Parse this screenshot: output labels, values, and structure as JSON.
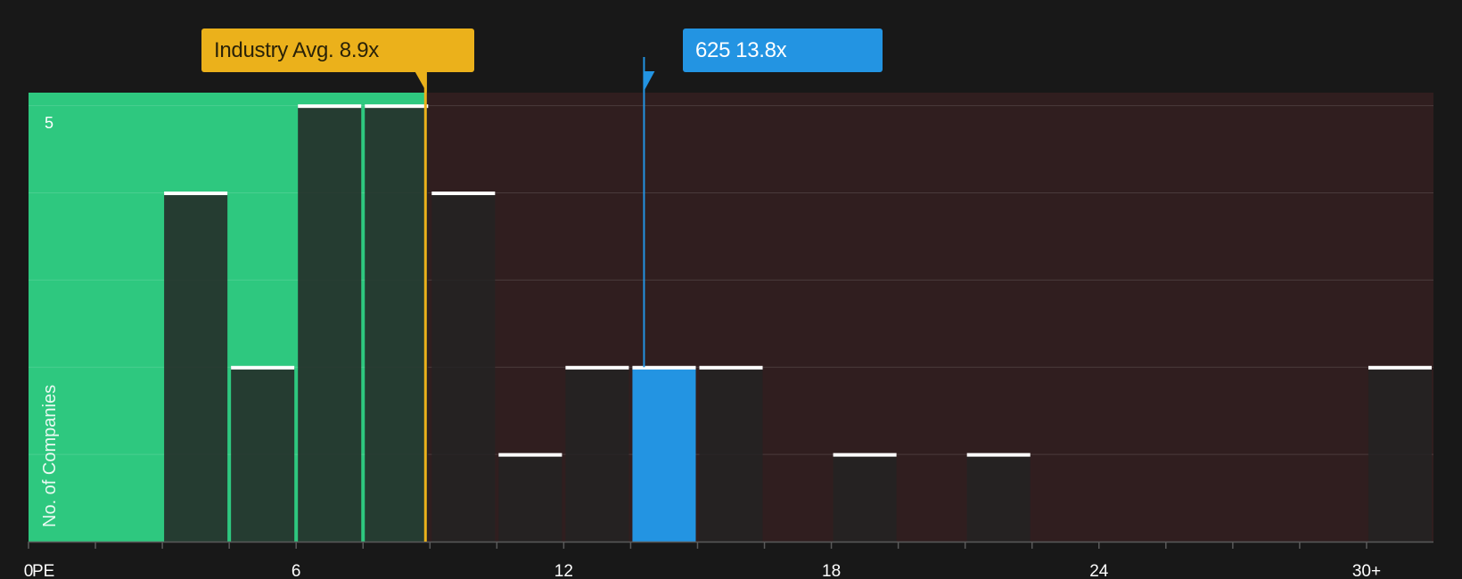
{
  "chart_data": {
    "type": "bar",
    "x_axis_label": "PE",
    "y_axis_label": "No. of Companies",
    "x_ticks": [
      "0",
      "6",
      "12",
      "18",
      "24",
      "30+"
    ],
    "y_ticks": [
      "5"
    ],
    "xlim": [
      0,
      31.5
    ],
    "ylim": [
      0,
      5.15
    ],
    "bin_width": 1.5,
    "bins": [
      {
        "start": 3.0,
        "value": 4
      },
      {
        "start": 4.5,
        "value": 2
      },
      {
        "start": 6.0,
        "value": 5
      },
      {
        "start": 7.5,
        "value": 5
      },
      {
        "start": 9.0,
        "value": 4
      },
      {
        "start": 10.5,
        "value": 1
      },
      {
        "start": 12.0,
        "value": 2
      },
      {
        "start": 13.5,
        "value": 2,
        "highlight": true
      },
      {
        "start": 15.0,
        "value": 2
      },
      {
        "start": 18.0,
        "value": 1
      },
      {
        "start": 21.0,
        "value": 1
      },
      {
        "start": 30.0,
        "value": 2
      }
    ],
    "industry_avg": {
      "label": "Industry Avg.",
      "value": 8.9,
      "display": "8.9x"
    },
    "company": {
      "name": "625",
      "value": 13.8,
      "display": "13.8x"
    },
    "colors": {
      "background": "#181818",
      "undervalued_region": "#2ec87f",
      "overvalued_region": "#301e1f",
      "bar_fill": "#232323",
      "bar_top": "#ffffff",
      "highlight_bar": "#2394e2",
      "industry_line": "#ebb11b",
      "company_line": "#2394e2"
    }
  }
}
